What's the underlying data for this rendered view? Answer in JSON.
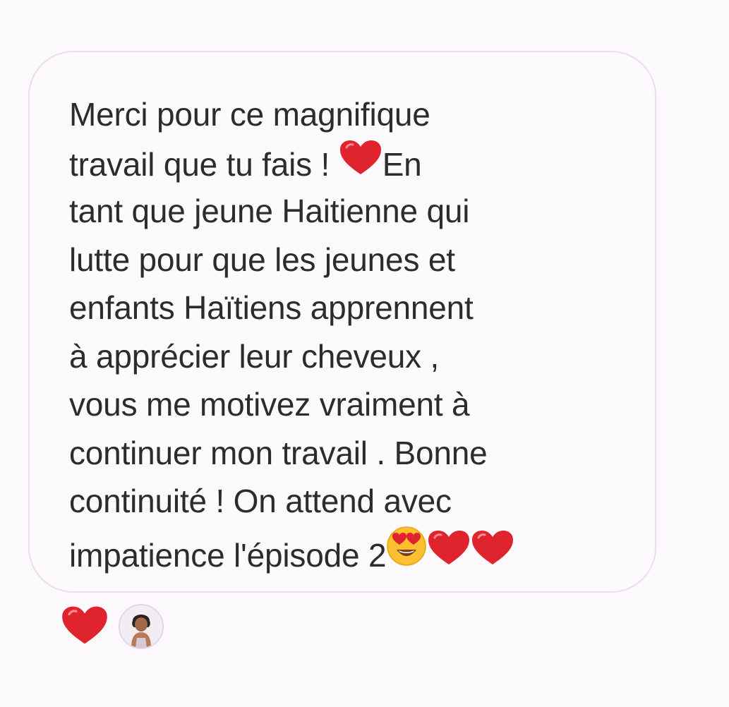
{
  "message": {
    "lines": [
      [
        "Merci pour ce magnifique"
      ],
      [
        "travail que tu fais ! ",
        "En"
      ],
      [
        "tant que jeune Haitienne qui"
      ],
      [
        "lutte pour que les jeunes et"
      ],
      [
        "enfants Haïtiens apprennent"
      ],
      [
        "à apprécier leur cheveux ,"
      ],
      [
        "vous me motivez vraiment à"
      ],
      [
        "continuer mon travail . Bonne"
      ],
      [
        "continuité ! On attend avec"
      ],
      [
        "impatience l'épisode 2"
      ]
    ],
    "emoji": {
      "line2": "heart-icon",
      "line10": [
        "heart-eyes-icon",
        "heart-icon",
        "heart-icon"
      ]
    }
  },
  "reactions": {
    "reaction_icon": "heart-icon",
    "reactor": "avatar"
  },
  "colors": {
    "text": "#2c2c2c",
    "heart": "#e0242e",
    "bubble_border": "#e6e1e6",
    "background": "#fcf9fc"
  }
}
